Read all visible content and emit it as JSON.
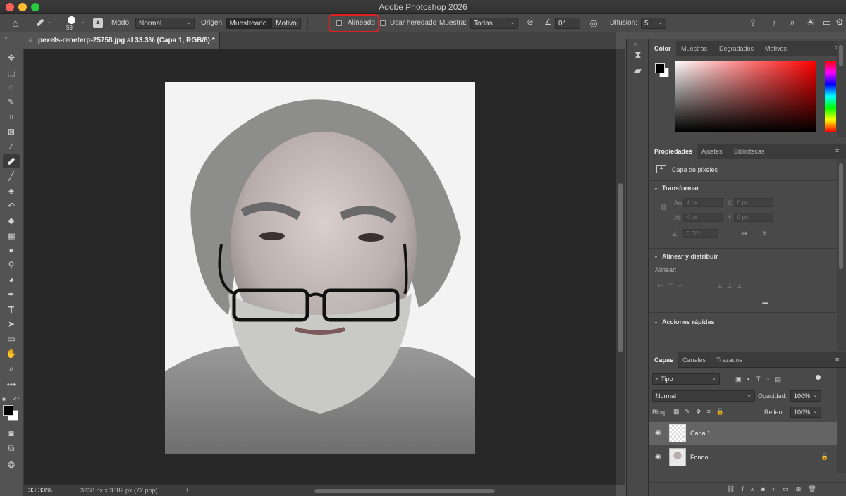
{
  "app_title": "Adobe Photoshop 2026",
  "options_bar": {
    "brush_size": "59",
    "mode_label": "Modo:",
    "mode_value": "Normal",
    "source_label": "Origen:",
    "source_sampled": "Muestreado",
    "source_pattern": "Motivo",
    "aligned_label": "Alineado",
    "aligned_checked": false,
    "use_legacy_label": "Usar heredado",
    "sample_label": "Muestra:",
    "sample_value": "Todas",
    "angle_value": "0°",
    "diffusion_label": "Difusión:",
    "diffusion_value": "5",
    "highlight_color": "#e02020"
  },
  "document_tab": {
    "close_glyph": "×",
    "title": "pexels-reneterp-25758.jpg al 33.3% (Capa 1, RGB/8) *"
  },
  "status_bar": {
    "zoom": "33.33%",
    "info": "3238 px x 3882 px (72 ppp)",
    "arrow": "›"
  },
  "tools": [
    "move-tool",
    "marquee-tool",
    "lasso-tool",
    "quick-selection-tool",
    "crop-tool",
    "frame-tool",
    "eyedropper-tool",
    "healing-brush-tool",
    "brush-tool",
    "clone-stamp-tool",
    "history-brush-tool",
    "eraser-tool",
    "gradient-tool",
    "blur-tool",
    "dodge-tool",
    "pen-tool",
    "type-tool",
    "path-selection-tool",
    "rectangle-tool",
    "hand-tool",
    "zoom-tool",
    "more-tools"
  ],
  "color_panel": {
    "tabs": [
      "Color",
      "Muestras",
      "Degradados",
      "Motivos"
    ],
    "active_tab": "Color",
    "foreground": "#000000",
    "background": "#ffffff",
    "hue_color": "#ff0000"
  },
  "properties_panel": {
    "tabs": [
      "Propiedades",
      "Ajustes",
      "Bibliotecas"
    ],
    "active_tab": "Propiedades",
    "layer_type": "Capa de píxeles",
    "transform_title": "Transformar",
    "width_label": "An",
    "width_value": "4 px",
    "x_label": "X",
    "x_value": "0 px",
    "height_label": "Al",
    "height_value": "4 px",
    "y_label": "Y",
    "y_value": "0 px",
    "angle_value": "0,00°",
    "align_title": "Alinear y distribuir",
    "align_label": "Alinear:",
    "more_glyph": "•••",
    "quick_actions_title": "Acciones rápidas"
  },
  "layers_panel": {
    "tabs": [
      "Capas",
      "Canales",
      "Trazados"
    ],
    "active_tab": "Capas",
    "filter_value": "Tipo",
    "blend_mode": "Normal",
    "opacity_label": "Opacidad:",
    "opacity_value": "100%",
    "lock_label": "Bloq.:",
    "fill_label": "Relleno:",
    "fill_value": "100%",
    "layers": [
      {
        "name": "Capa 1",
        "selected": true,
        "visible": true,
        "locked": false
      },
      {
        "name": "Fondo",
        "selected": false,
        "visible": true,
        "locked": true
      }
    ]
  }
}
